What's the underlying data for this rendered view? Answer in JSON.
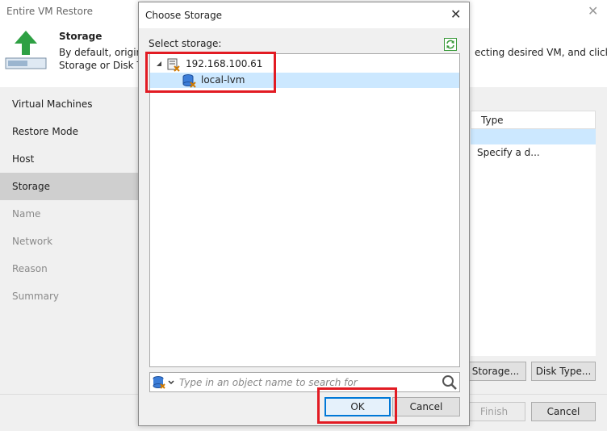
{
  "wizard": {
    "title": "Entire VM Restore",
    "heading": "Storage",
    "desc_line1": "By default, original",
    "desc_line1_right": "ecting desired VM, and clicking",
    "desc_line2": "Storage or Disk Typ",
    "steps": [
      {
        "label": "Virtual Machines"
      },
      {
        "label": "Restore Mode"
      },
      {
        "label": "Host"
      },
      {
        "label": "Storage"
      },
      {
        "label": "Name"
      },
      {
        "label": "Network"
      },
      {
        "label": "Reason"
      },
      {
        "label": "Summary"
      }
    ],
    "grid_header": "Type",
    "grid_cell": "Specify a d...",
    "storage_button": "Storage...",
    "disk_type_button": "Disk Type...",
    "finish_button": "Finish",
    "cancel_button": "Cancel"
  },
  "dialog": {
    "title": "Choose Storage",
    "select_label": "Select storage:",
    "tree": [
      {
        "label": "192.168.100.61",
        "icon": "host-server-icon"
      },
      {
        "label": "local-lvm",
        "icon": "datastore-icon"
      }
    ],
    "search_placeholder": "Type in an object name to search for",
    "ok_button": "OK",
    "cancel_button": "Cancel"
  },
  "colors": {
    "highlight": "#e21b23",
    "selection": "#cce8ff",
    "accent": "#0078d7",
    "green_arrow": "#2ea043"
  }
}
